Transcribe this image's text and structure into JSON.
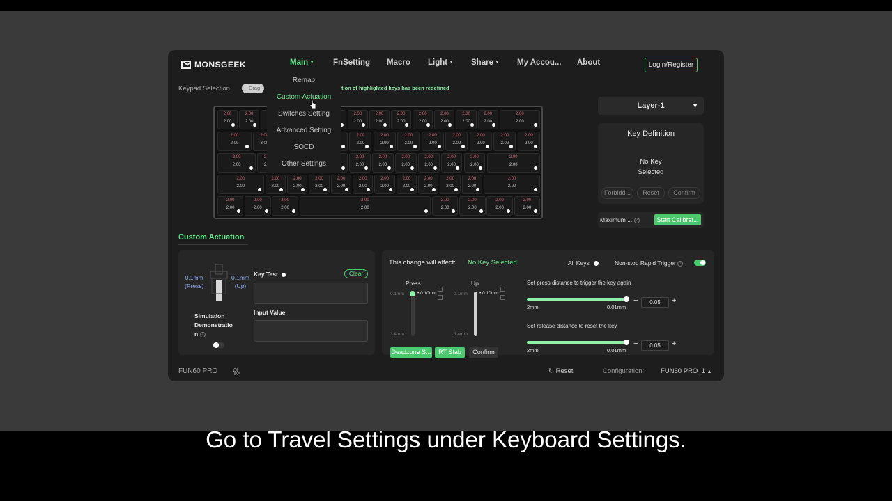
{
  "caption": "Go to Travel Settings under Keyboard Settings.",
  "brand": "MONSGEEK",
  "nav": {
    "main": "Main",
    "fnsetting": "FnSetting",
    "macro": "Macro",
    "light": "Light",
    "share": "Share",
    "account": "My Accou...",
    "about": "About",
    "login": "Login/Register"
  },
  "main_menu": [
    "Remap",
    "Custom Actuation",
    "Switches Setting",
    "Advanced Setting",
    "SOCD",
    "Other Settings"
  ],
  "keypad": {
    "label": "Keypad Selection",
    "toggle": "Drag",
    "notice": "tion of highlighted keys has been redefined"
  },
  "keyboard": {
    "rows": [
      [
        [
          "2.00",
          "2.00"
        ],
        [
          "2.00",
          "2.00"
        ],
        [
          "",
          ""
        ],
        [
          "",
          ""
        ],
        [
          "",
          ""
        ],
        [
          "",
          ""
        ],
        [
          "2.00",
          "2.00"
        ],
        [
          "2.00",
          "2.00"
        ],
        [
          "2.00",
          "2.00"
        ],
        [
          "2.00",
          "2.00"
        ],
        [
          "2.00",
          "2.00"
        ],
        [
          "2.00",
          "2.00"
        ],
        [
          "2.00",
          "2.00"
        ],
        [
          "2.00",
          "2.00"
        ]
      ],
      [
        [
          "2.00",
          "2.00"
        ],
        [
          "2.00",
          "2.00"
        ],
        [
          "",
          ""
        ],
        [
          "",
          ""
        ],
        [
          "",
          ""
        ],
        [
          "2.00",
          "2.00"
        ],
        [
          "2.00",
          "2.00"
        ],
        [
          "2.00",
          "2.00"
        ],
        [
          "2.00",
          "2.00"
        ],
        [
          "2.00",
          "2.00"
        ],
        [
          "2.00",
          "2.00"
        ],
        [
          "2.00",
          "2.00"
        ],
        [
          "2.00",
          "2.00"
        ]
      ],
      [
        [
          "2.00",
          "2.00"
        ],
        [
          "2.00",
          "2.00"
        ],
        [
          "",
          ""
        ],
        [
          "",
          ""
        ],
        [
          "",
          ""
        ],
        [
          "2.00",
          "2.00"
        ],
        [
          "2.00",
          "2.00"
        ],
        [
          "2.00",
          "2.00"
        ],
        [
          "2.00",
          "2.00"
        ],
        [
          "2.00",
          "2.00"
        ],
        [
          "2.00",
          "2.00"
        ],
        [
          "2.00",
          "2.00"
        ]
      ],
      [
        [
          "2.00",
          "2.00"
        ],
        [
          "2.00",
          "2.00"
        ],
        [
          "2.00",
          "2.00"
        ],
        [
          "2.00",
          "2.00"
        ],
        [
          "2.00",
          "2.00"
        ],
        [
          "2.00",
          "2.00"
        ],
        [
          "2.00",
          "2.00"
        ],
        [
          "2.00",
          "2.00"
        ],
        [
          "2.00",
          "2.00"
        ],
        [
          "2.00",
          "2.00"
        ],
        [
          "2.00",
          "2.00"
        ],
        [
          "2.00",
          "2.00"
        ]
      ],
      [
        [
          "2.00",
          "2.00"
        ],
        [
          "2.00",
          "2.00"
        ],
        [
          "2.00",
          "2.00"
        ],
        [
          "2.00",
          "2.00"
        ],
        [
          "2.00",
          "2.00"
        ],
        [
          "2.00",
          "2.00"
        ],
        [
          "2.00",
          "2.00"
        ],
        [
          "2.00",
          "2.00"
        ]
      ]
    ]
  },
  "layer": {
    "selected": "Layer-1"
  },
  "key_definition": {
    "title": "Key Definition",
    "empty_line1": "No Key",
    "empty_line2": "Selected",
    "forbid": "Forbidd...",
    "reset": "Reset",
    "confirm": "Confirm"
  },
  "calibration": {
    "label": "Maximum ...",
    "button": "Start Calibrat..."
  },
  "section_title": "Custom Actuation",
  "simulation": {
    "press_value": "0.1mm",
    "press_label": "(Press)",
    "up_value": "0.1mm",
    "up_label": "(Up)",
    "title": "Simulation Demonstratio n",
    "key_test": "Key Test",
    "clear": "Clear",
    "input_value": "Input Value"
  },
  "rapid_trigger": {
    "affect_label": "This change will affect:",
    "affect_value": "No Key Selected",
    "all_keys": "All Keys",
    "nonstop": "Non-stop Rapid Trigger",
    "press_label": "Press",
    "up_label": "Up",
    "press_top": "0.1mm",
    "press_bottom": "3.4mm",
    "press_value": "0.10mm",
    "up_top": "0.1mm",
    "up_bottom": "3.4mm",
    "up_value": "0.10mm",
    "deadzone": "Deadzone S...",
    "rt_stab": "RT Stab",
    "confirm": "Confirm",
    "press_again_label": "Set press distance to trigger the key again",
    "press_again_min": "2mm",
    "press_again_max": "0.01mm",
    "press_again_value": "0.05",
    "release_label": "Set release distance to reset the key",
    "release_min": "2mm",
    "release_max": "0.01mm",
    "release_value": "0.05"
  },
  "footer": {
    "model": "FUN60 PRO",
    "reset": "Reset",
    "config_label": "Configuration:",
    "config_value": "FUN60 PRO_1"
  },
  "colors": {
    "accent": "#4cc96e",
    "accent_text": "#6ce58e",
    "background": "#1d1d1d"
  }
}
